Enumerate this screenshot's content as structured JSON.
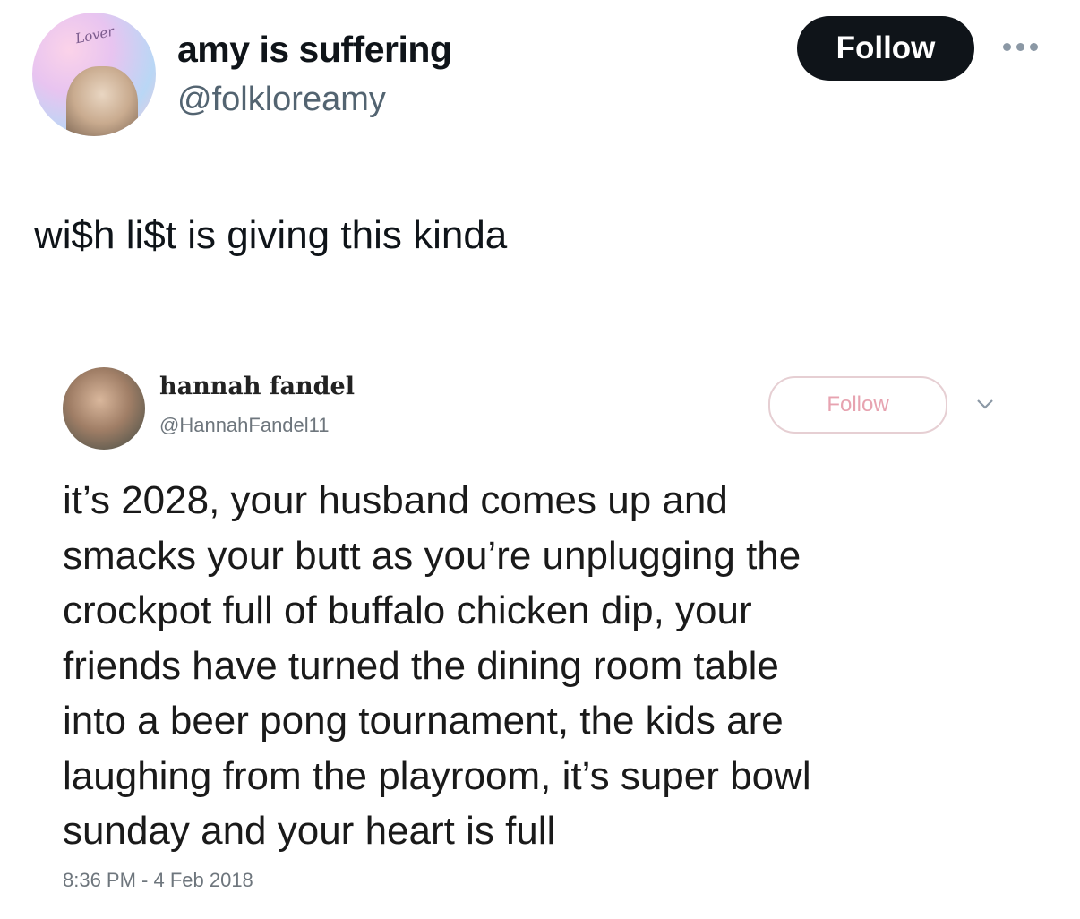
{
  "tweet": {
    "display_name": "amy is suffering",
    "handle": "@folkloreamy",
    "avatar_script": "Lover",
    "follow_label": "Follow",
    "more_icon": "more-horizontal-icon",
    "text": "wi$h li$t is giving this kinda"
  },
  "quoted_tweet": {
    "display_name": "hannah fandel",
    "handle": "@HannahFandel11",
    "follow_label": "Follow",
    "chevron_icon": "chevron-down-icon",
    "body": "it’s 2028, your husband comes up and\nsmacks your butt as you’re unplugging the\ncrockpot full of buffalo chicken dip, your\nfriends have turned the dining room table\ninto a beer pong tournament, the kids are\nlaughing from the playroom, it’s super bowl\nsunday and your heart is full",
    "timestamp": "8:36 PM - 4 Feb 2018"
  },
  "colors": {
    "follow_bg": "#0f1419",
    "secondary_text": "#536471",
    "quoted_follow_text": "#e7a3b0"
  }
}
